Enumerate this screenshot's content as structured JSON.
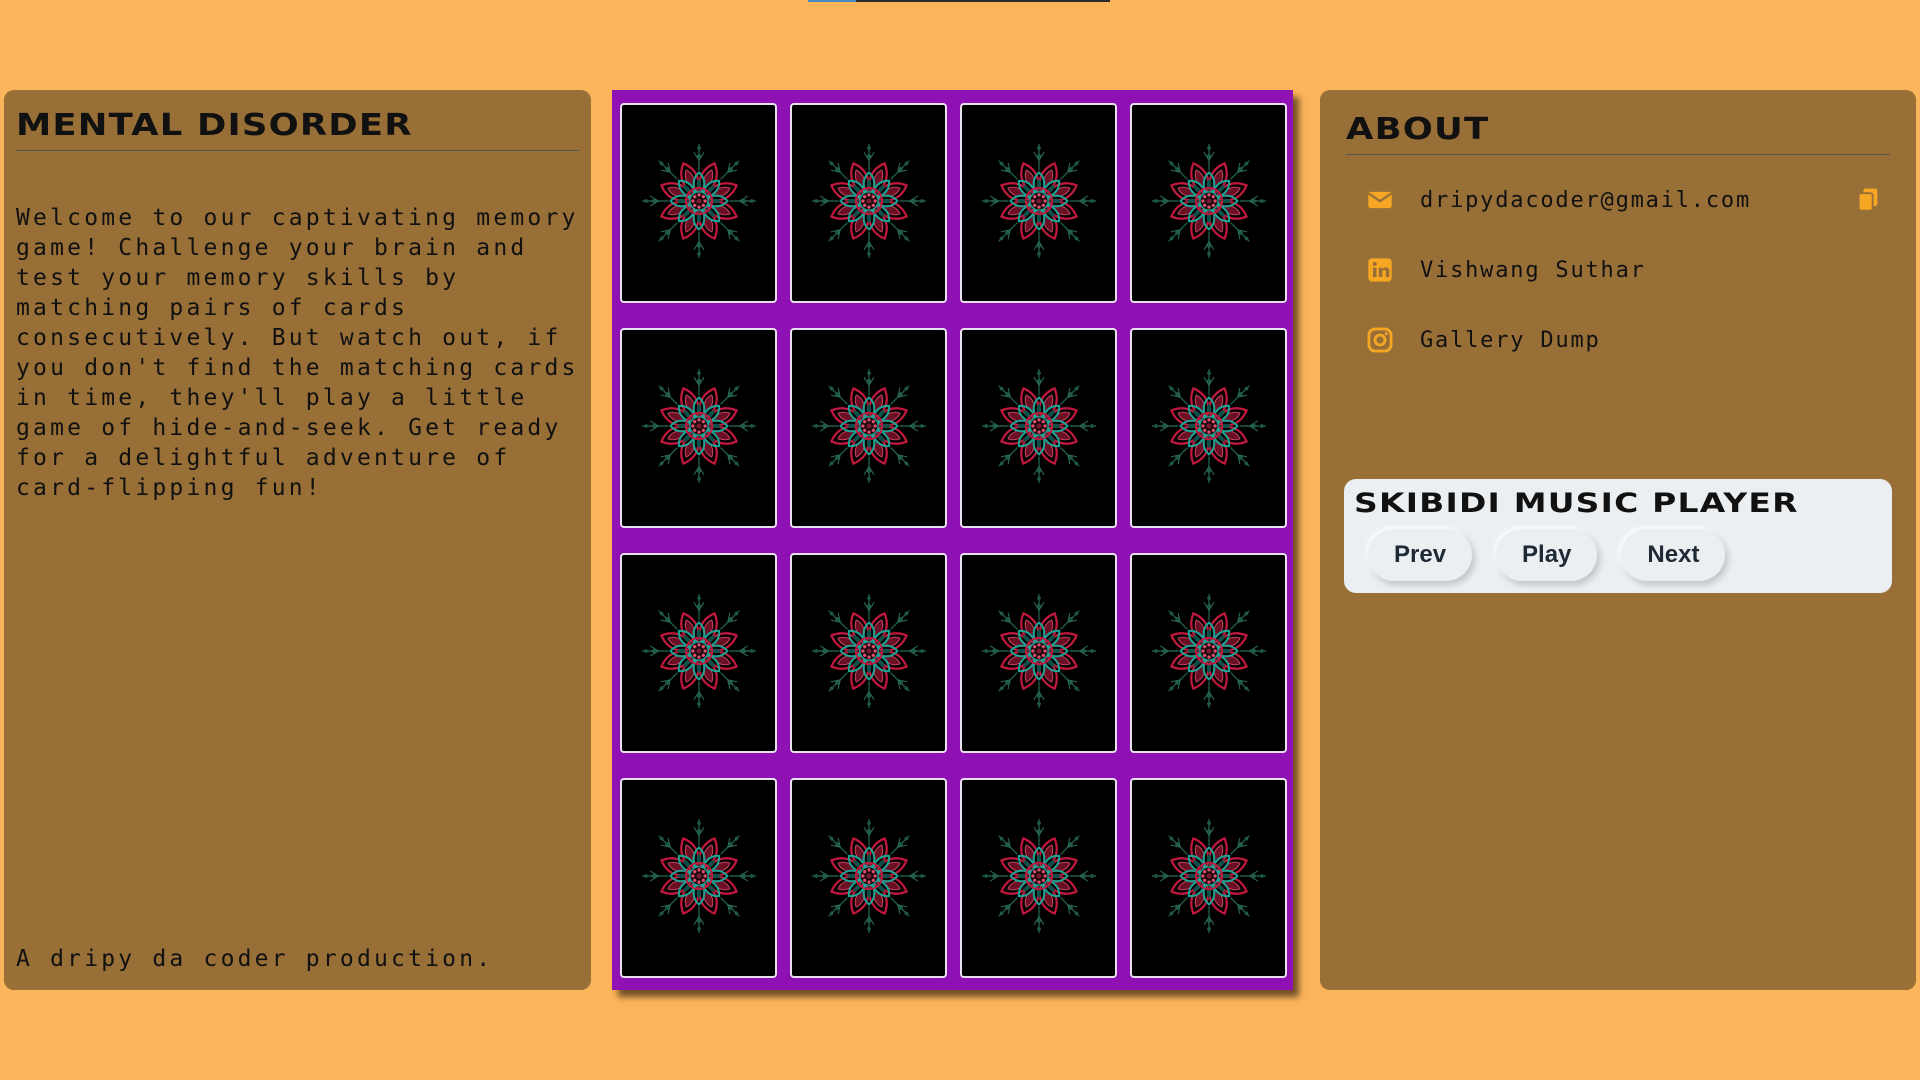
{
  "colors": {
    "background": "#FCB45A",
    "panel": "#986F37",
    "board": "#8F11B3",
    "card_back": "#000000",
    "icon_accent": "#F5A623",
    "player_bg": "#ECEFF1"
  },
  "load_progress": 0.16,
  "left_panel": {
    "title": "Mental Disorder",
    "description": "Welcome to our captivating memory game! Challenge your brain and test your memory skills by matching pairs of cards consecutively. But watch out, if you don't find the matching cards in time, they'll play a little game of hide-and-seek. Get ready for a delightful adventure of card-flipping fun!",
    "credit": "A dripy da coder production."
  },
  "board": {
    "rows": 4,
    "columns": 4,
    "card_back_icon": "mandala-icon",
    "cards": [
      "card-1",
      "card-2",
      "card-3",
      "card-4",
      "card-5",
      "card-6",
      "card-7",
      "card-8",
      "card-9",
      "card-10",
      "card-11",
      "card-12",
      "card-13",
      "card-14",
      "card-15",
      "card-16"
    ]
  },
  "about": {
    "title": "About",
    "contacts": [
      {
        "icon": "envelope-icon",
        "text": "dripydacoder@gmail.com",
        "copy_icon": "copy-icon"
      },
      {
        "icon": "linkedin-icon",
        "text": "Vishwang Suthar"
      },
      {
        "icon": "instagram-icon",
        "text": "Gallery Dump"
      }
    ]
  },
  "music_player": {
    "title": "Skibidi Music Player",
    "buttons": [
      "Prev",
      "Play",
      "Next"
    ]
  }
}
